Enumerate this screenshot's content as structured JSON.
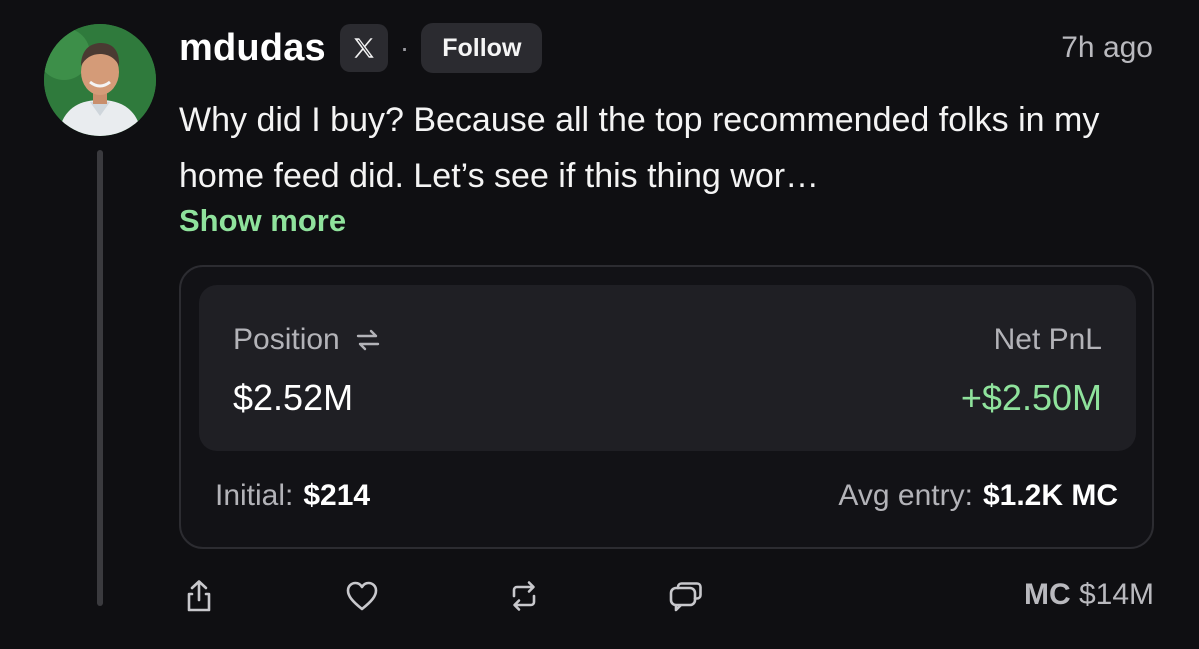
{
  "post": {
    "username": "mdudas",
    "platform_icon": "x-logo-icon",
    "separator": "·",
    "follow_label": "Follow",
    "time": "7h ago",
    "text": "Why did I buy? Because all the top recommended folks in my home feed did. Let’s see if this thing wor…",
    "show_more": "Show more"
  },
  "card": {
    "position_label": "Position",
    "position_icon": "swap-arrows-icon",
    "position_value": "$2.52M",
    "pnl_label": "Net PnL",
    "pnl_value": "+$2.50M",
    "initial_label": "Initial:",
    "initial_value": "$214",
    "avg_entry_label": "Avg entry:",
    "avg_entry_value": "$1.2K MC"
  },
  "actions": {
    "icons": [
      "share-icon",
      "heart-icon",
      "repost-icon",
      "comment-icon"
    ],
    "mc_label": "MC",
    "mc_value": "$14M"
  },
  "colors": {
    "background": "#0f0f12",
    "accent_green": "#8fe29c",
    "card_inner": "#1f1f24",
    "muted_text": "#b3b3b8"
  }
}
